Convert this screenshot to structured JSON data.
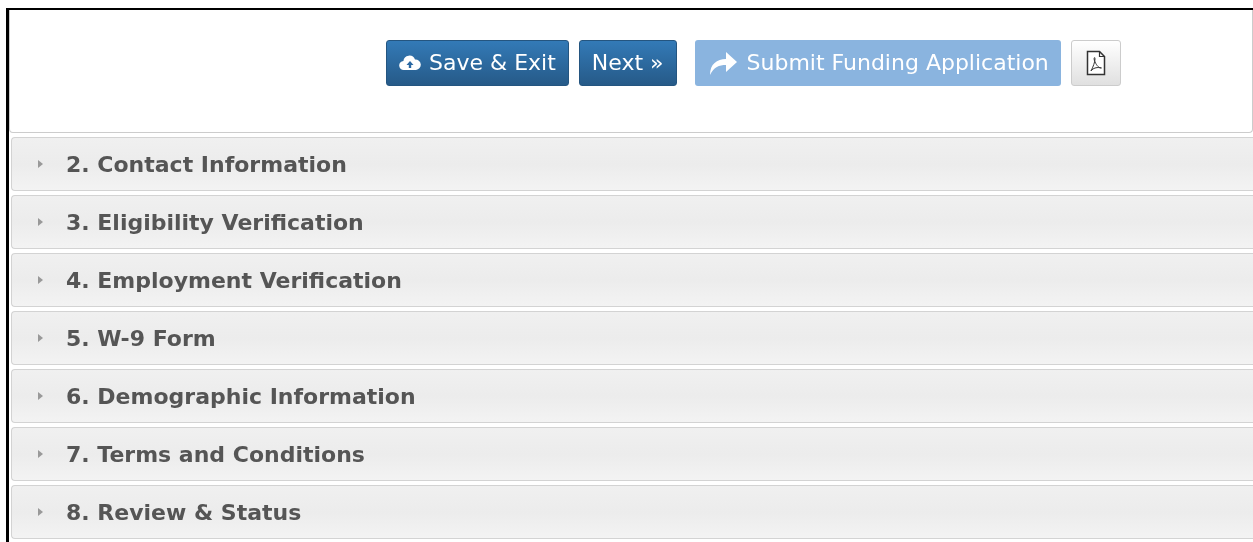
{
  "toolbar": {
    "buttons": [
      {
        "kind": "save",
        "label": "Save & Exit",
        "disabled": false
      },
      {
        "kind": "next",
        "label": "Next »",
        "disabled": false
      },
      {
        "kind": "submit",
        "label": "Submit Funding Application",
        "disabled": true
      },
      {
        "kind": "pdf",
        "disabled": false
      }
    ]
  },
  "sections": [
    {
      "title": "2. Contact Information",
      "expanded": false
    },
    {
      "title": "3. Eligibility Verification",
      "expanded": false
    },
    {
      "title": "4. Employment Verification",
      "expanded": false
    },
    {
      "title": "5. W-9 Form",
      "expanded": false
    },
    {
      "title": "6. Demographic Information",
      "expanded": false
    },
    {
      "title": "7. Terms and Conditions",
      "expanded": false
    },
    {
      "title": "8. Review & Status",
      "expanded": false
    }
  ]
}
